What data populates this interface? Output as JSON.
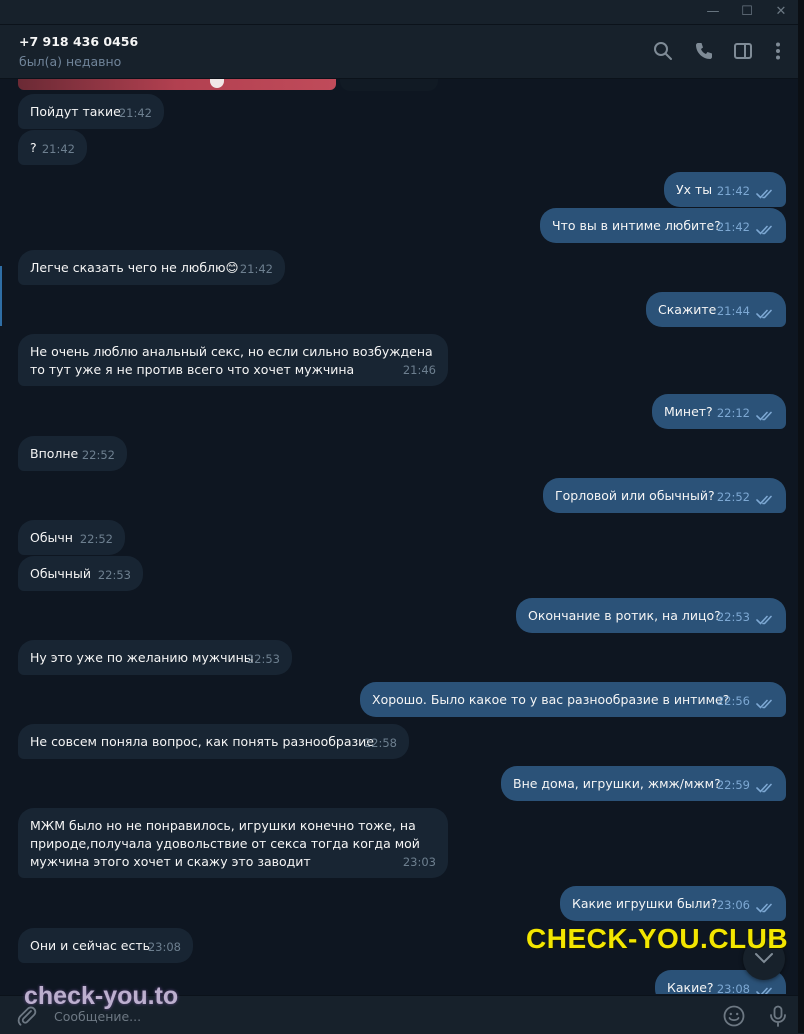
{
  "window": {
    "minimize": "—",
    "maximize": "☐",
    "close": "✕"
  },
  "header": {
    "contact_name": "+7 918 436 0456",
    "status": "был(а) недавно",
    "icons": [
      "search-icon",
      "phone-icon",
      "sidebar-toggle-icon",
      "more-icon"
    ]
  },
  "messages": [
    {
      "dir": "in",
      "text": "Пойдут такие",
      "time": "21:42"
    },
    {
      "dir": "in",
      "text": "?",
      "time": "21:42"
    },
    {
      "dir": "out",
      "text": "Ух ты",
      "time": "21:42"
    },
    {
      "dir": "out",
      "text": "Что вы в интиме любите?",
      "time": "21:42"
    },
    {
      "dir": "in",
      "text": "Легче сказать чего не люблю😊",
      "time": "21:42"
    },
    {
      "dir": "out",
      "text": "Скажите",
      "time": "21:44"
    },
    {
      "dir": "in",
      "text": "Не очень люблю анальный секс, но если сильно возбуждена то тут уже я не против всего что хочет мужчина",
      "time": "21:46"
    },
    {
      "dir": "out",
      "text": "Минет?",
      "time": "22:12"
    },
    {
      "dir": "in",
      "text": "Вполне",
      "time": "22:52"
    },
    {
      "dir": "out",
      "text": "Горловой или обычный?",
      "time": "22:52"
    },
    {
      "dir": "in",
      "text": "Обычн",
      "time": "22:52"
    },
    {
      "dir": "in",
      "text": "Обычный",
      "time": "22:53"
    },
    {
      "dir": "out",
      "text": "Окончание в ротик, на лицо?",
      "time": "22:53"
    },
    {
      "dir": "in",
      "text": "Ну это уже по желанию мужчины",
      "time": "22:53"
    },
    {
      "dir": "out",
      "text": "Хорошо. Было какое то у вас разнообразие в интиме?",
      "time": "22:56"
    },
    {
      "dir": "in",
      "text": "Не совсем поняла вопрос, как понять разнообразие",
      "time": "22:58"
    },
    {
      "dir": "out",
      "text": "Вне дома, игрушки, жмж/мжм?",
      "time": "22:59"
    },
    {
      "dir": "in",
      "text": "МЖМ было но не понравилось, игрушки конечно тоже, на природе,получала удовольствие от секса тогда когда мой мужчина этого хочет и скажу это заводит",
      "time": "23:03"
    },
    {
      "dir": "out",
      "text": "Какие игрушки были?",
      "time": "23:06"
    },
    {
      "dir": "in",
      "text": "Они и сейчас есть",
      "time": "23:08"
    },
    {
      "dir": "out",
      "text": "Какие?",
      "time": "23:08"
    }
  ],
  "composer": {
    "placeholder": "Сообщение..."
  },
  "watermarks": {
    "primary": "CHECK-YOU.CLUB",
    "secondary": "check-you.to"
  },
  "colors": {
    "background": "#0e1621",
    "incoming_bubble": "#182533",
    "outgoing_bubble": "#2b5278",
    "panel": "#17212b",
    "accent": "#5eb5f7"
  }
}
